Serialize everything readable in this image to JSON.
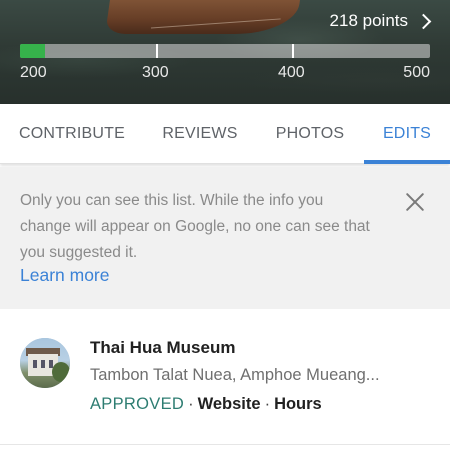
{
  "header": {
    "points_label": "218 points",
    "progress": {
      "min": 200,
      "max": 500,
      "current": 218
    },
    "ticks": [
      "200",
      "300",
      "400",
      "500"
    ],
    "tick_values": [
      200,
      300,
      400,
      500
    ],
    "bar_color": "#36b24b"
  },
  "tabs": [
    {
      "label": "CONTRIBUTE",
      "active": false
    },
    {
      "label": "REVIEWS",
      "active": false
    },
    {
      "label": "PHOTOS",
      "active": false
    },
    {
      "label": "EDITS",
      "active": true
    }
  ],
  "banner": {
    "text": "Only you can see this list. While the info you change will appear on Google, no one can see that you suggested it.",
    "link_label": "Learn more"
  },
  "edits": [
    {
      "title": "Thai Hua Museum",
      "address": "Tambon Talat Nuea, Amphoe Mueang...",
      "status": "APPROVED",
      "fields": [
        "Website",
        "Hours"
      ]
    }
  ],
  "colors": {
    "accent": "#3b82d6",
    "approved": "#2e7d72"
  }
}
